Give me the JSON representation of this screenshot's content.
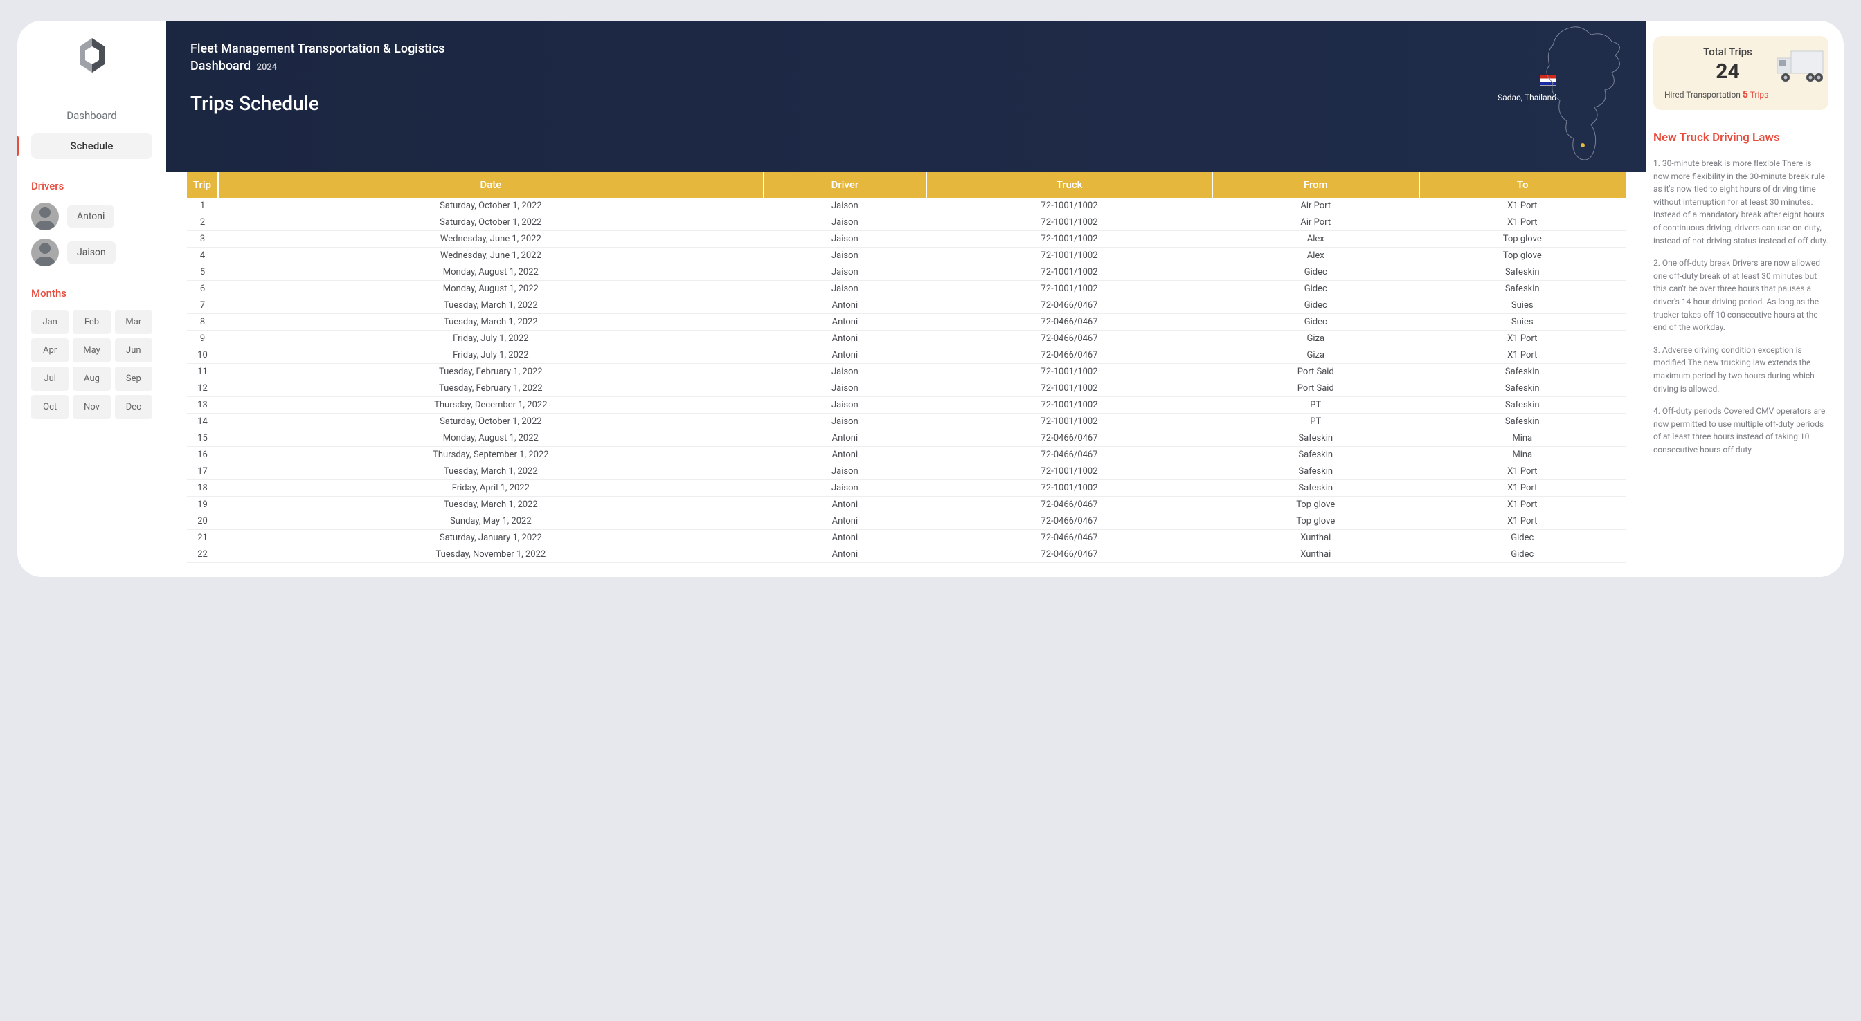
{
  "nav": {
    "dashboard": "Dashboard",
    "schedule": "Schedule"
  },
  "sidebar": {
    "drivers_title": "Drivers",
    "drivers": [
      {
        "name": "Antoni"
      },
      {
        "name": "Jaison"
      }
    ],
    "months_title": "Months",
    "months": [
      "Jan",
      "Feb",
      "Mar",
      "Apr",
      "May",
      "Jun",
      "Jul",
      "Aug",
      "Sep",
      "Oct",
      "Nov",
      "Dec"
    ]
  },
  "header": {
    "title_line1": "Fleet Management Transportation & Logistics",
    "title_line2": "Dashboard",
    "year": "2024",
    "page_title": "Trips Schedule",
    "location": "Sadao, Thailand"
  },
  "table": {
    "headers": [
      "Trip",
      "Date",
      "Driver",
      "Truck",
      "From",
      "To"
    ],
    "rows": [
      [
        "1",
        "Saturday, October 1, 2022",
        "Jaison",
        "72-1001/1002",
        "Air Port",
        "X1 Port"
      ],
      [
        "2",
        "Saturday, October 1, 2022",
        "Jaison",
        "72-1001/1002",
        "Air Port",
        "X1 Port"
      ],
      [
        "3",
        "Wednesday, June 1, 2022",
        "Jaison",
        "72-1001/1002",
        "Alex",
        "Top glove"
      ],
      [
        "4",
        "Wednesday, June 1, 2022",
        "Jaison",
        "72-1001/1002",
        "Alex",
        "Top glove"
      ],
      [
        "5",
        "Monday, August 1, 2022",
        "Jaison",
        "72-1001/1002",
        "Gidec",
        "Safeskin"
      ],
      [
        "6",
        "Monday, August 1, 2022",
        "Jaison",
        "72-1001/1002",
        "Gidec",
        "Safeskin"
      ],
      [
        "7",
        "Tuesday, March 1, 2022",
        "Antoni",
        "72-0466/0467",
        "Gidec",
        "Suies"
      ],
      [
        "8",
        "Tuesday, March 1, 2022",
        "Antoni",
        "72-0466/0467",
        "Gidec",
        "Suies"
      ],
      [
        "9",
        "Friday, July 1, 2022",
        "Antoni",
        "72-0466/0467",
        "Giza",
        "X1 Port"
      ],
      [
        "10",
        "Friday, July 1, 2022",
        "Antoni",
        "72-0466/0467",
        "Giza",
        "X1 Port"
      ],
      [
        "11",
        "Tuesday, February 1, 2022",
        "Jaison",
        "72-1001/1002",
        "Port Said",
        "Safeskin"
      ],
      [
        "12",
        "Tuesday, February 1, 2022",
        "Jaison",
        "72-1001/1002",
        "Port Said",
        "Safeskin"
      ],
      [
        "13",
        "Thursday, December 1, 2022",
        "Jaison",
        "72-1001/1002",
        "PT",
        "Safeskin"
      ],
      [
        "14",
        "Saturday, October 1, 2022",
        "Jaison",
        "72-1001/1002",
        "PT",
        "Safeskin"
      ],
      [
        "15",
        "Monday, August 1, 2022",
        "Antoni",
        "72-0466/0467",
        "Safeskin",
        "Mina"
      ],
      [
        "16",
        "Thursday, September 1, 2022",
        "Antoni",
        "72-0466/0467",
        "Safeskin",
        "Mina"
      ],
      [
        "17",
        "Tuesday, March 1, 2022",
        "Jaison",
        "72-1001/1002",
        "Safeskin",
        "X1 Port"
      ],
      [
        "18",
        "Friday, April 1, 2022",
        "Jaison",
        "72-1001/1002",
        "Safeskin",
        "X1 Port"
      ],
      [
        "19",
        "Tuesday, March 1, 2022",
        "Antoni",
        "72-0466/0467",
        "Top glove",
        "X1 Port"
      ],
      [
        "20",
        "Sunday, May 1, 2022",
        "Antoni",
        "72-0466/0467",
        "Top glove",
        "X1 Port"
      ],
      [
        "21",
        "Saturday, January 1, 2022",
        "Antoni",
        "72-0466/0467",
        "Xunthai",
        "Gidec"
      ],
      [
        "22",
        "Tuesday, November 1, 2022",
        "Antoni",
        "72-0466/0467",
        "Xunthai",
        "Gidec"
      ]
    ]
  },
  "trips_card": {
    "label": "Total Trips",
    "count": "24",
    "hired_label": "Hired Transportation",
    "hired_count": "5",
    "hired_unit": "Trips"
  },
  "laws": {
    "title": "New Truck Driving Laws",
    "paragraphs": [
      "1. 30-minute break is more flexible\nThere is now more flexibility in the 30-minute break rule as it's now tied to eight hours of driving time without interruption for at least 30 minutes. Instead of a mandatory break after eight hours of continuous driving, drivers can use on-duty, instead of not-driving status instead of off-duty.",
      "2. One off-duty break\nDrivers are now allowed one off-duty break of at least 30 minutes but this can't be over three hours that pauses a driver's 14-hour driving period. As long as the trucker takes off 10 consecutive hours at the end of the workday.",
      "3. Adverse driving condition exception is modified\nThe new trucking law extends the maximum period by two hours during which driving is allowed.",
      "4. Off-duty periods\nCovered CMV operators are now permitted to use multiple off-duty periods of at least three hours instead of taking 10 consecutive hours off-duty."
    ]
  }
}
